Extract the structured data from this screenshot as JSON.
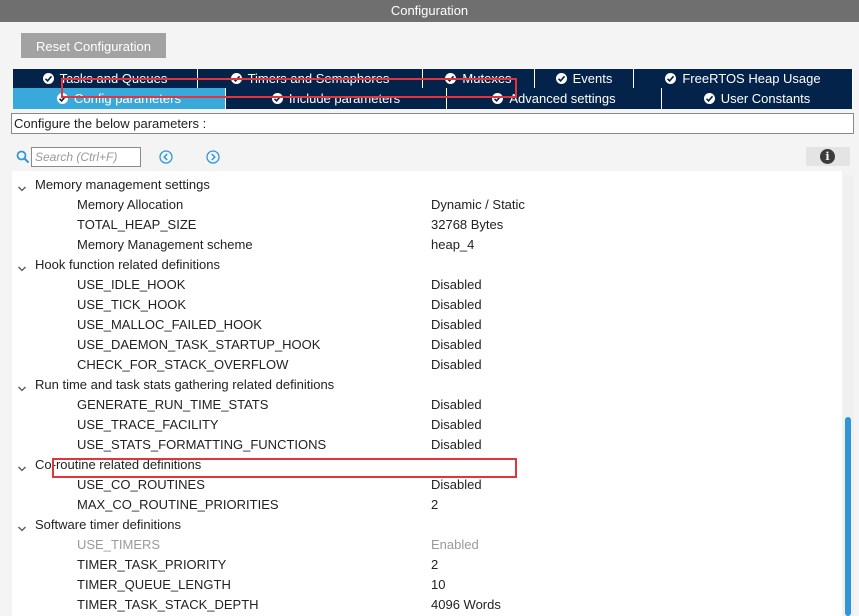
{
  "window": {
    "title": "Configuration"
  },
  "toolbar": {
    "reset_label": "Reset Configuration"
  },
  "tabs_row1": [
    {
      "label": "Tasks and Queues",
      "icon": "check-circle-icon"
    },
    {
      "label": "Timers and Semaphores",
      "icon": "check-circle-icon"
    },
    {
      "label": "Mutexes",
      "icon": "check-circle-icon"
    },
    {
      "label": "Events",
      "icon": "check-circle-icon"
    },
    {
      "label": "FreeRTOS Heap Usage",
      "icon": "check-circle-icon"
    }
  ],
  "tabs_row2": [
    {
      "label": "Config parameters",
      "icon": "check-circle-icon",
      "active": true
    },
    {
      "label": "Include parameters",
      "icon": "check-circle-icon"
    },
    {
      "label": "Advanced settings",
      "icon": "check-circle-icon"
    },
    {
      "label": "User Constants",
      "icon": "check-circle-icon"
    }
  ],
  "description": "Configure the below parameters :",
  "search": {
    "placeholder": "Search (Ctrl+F)",
    "value": ""
  },
  "tree": [
    {
      "kind": "group",
      "label": "Memory management settings"
    },
    {
      "kind": "param",
      "label": "Memory Allocation",
      "value": "Dynamic / Static"
    },
    {
      "kind": "param",
      "label": "TOTAL_HEAP_SIZE",
      "value": "32768 Bytes",
      "highlighted": true
    },
    {
      "kind": "param",
      "label": "Memory Management scheme",
      "value": "heap_4"
    },
    {
      "kind": "group",
      "label": "Hook function related definitions"
    },
    {
      "kind": "param",
      "label": "USE_IDLE_HOOK",
      "value": "Disabled"
    },
    {
      "kind": "param",
      "label": "USE_TICK_HOOK",
      "value": "Disabled"
    },
    {
      "kind": "param",
      "label": "USE_MALLOC_FAILED_HOOK",
      "value": "Disabled"
    },
    {
      "kind": "param",
      "label": "USE_DAEMON_TASK_STARTUP_HOOK",
      "value": "Disabled"
    },
    {
      "kind": "param",
      "label": "CHECK_FOR_STACK_OVERFLOW",
      "value": "Disabled"
    },
    {
      "kind": "group",
      "label": "Run time and task stats gathering related definitions"
    },
    {
      "kind": "param",
      "label": "GENERATE_RUN_TIME_STATS",
      "value": "Disabled"
    },
    {
      "kind": "param",
      "label": "USE_TRACE_FACILITY",
      "value": "Disabled"
    },
    {
      "kind": "param",
      "label": "USE_STATS_FORMATTING_FUNCTIONS",
      "value": "Disabled"
    },
    {
      "kind": "group",
      "label": "Co-routine related definitions"
    },
    {
      "kind": "param",
      "label": "USE_CO_ROUTINES",
      "value": "Disabled"
    },
    {
      "kind": "param",
      "label": "MAX_CO_ROUTINE_PRIORITIES",
      "value": "2"
    },
    {
      "kind": "group",
      "label": "Software timer definitions"
    },
    {
      "kind": "param",
      "label": "USE_TIMERS",
      "value": "Enabled",
      "disabled": true
    },
    {
      "kind": "param",
      "label": "TIMER_TASK_PRIORITY",
      "value": "2"
    },
    {
      "kind": "param",
      "label": "TIMER_QUEUE_LENGTH",
      "value": "10"
    },
    {
      "kind": "param",
      "label": "TIMER_TASK_STACK_DEPTH",
      "value": "4096 Words",
      "highlighted": true
    }
  ],
  "colors": {
    "tab_bg": "#03234b",
    "tab_active": "#39a9dc",
    "highlight": "#e2343a",
    "scroll_thumb": "#2f97d8"
  }
}
